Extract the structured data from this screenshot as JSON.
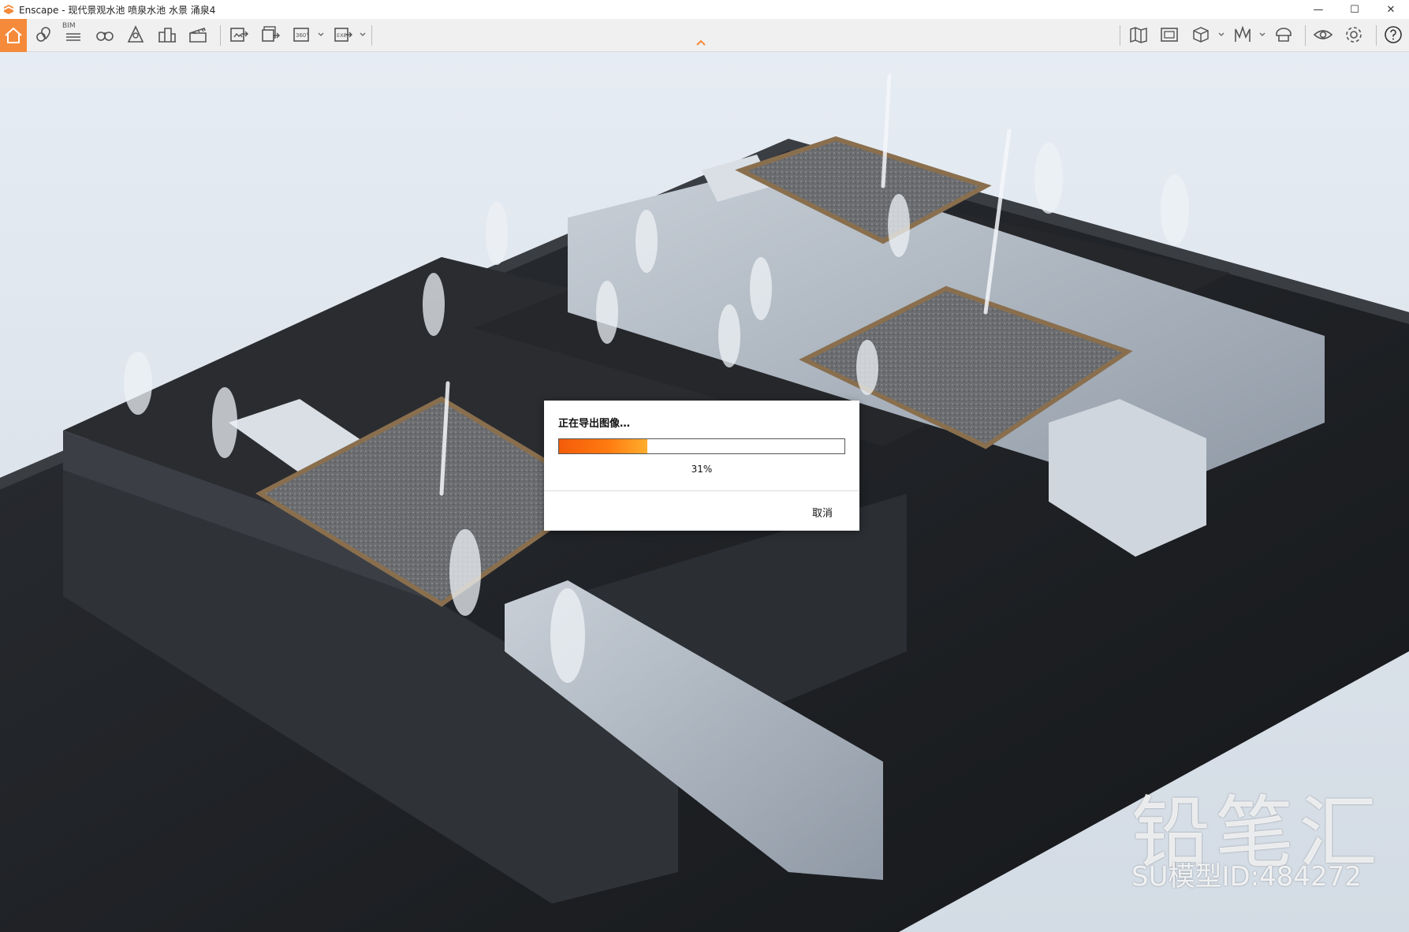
{
  "window": {
    "app_name": "Enscape",
    "title": "Enscape - 现代景观水池 喷泉水池 水景 涌泉4",
    "controls": [
      "—",
      "☐",
      "✕"
    ]
  },
  "toolbar": {
    "bim_label": "BIM",
    "icons": [
      "home-icon",
      "location-pin-icon",
      "bim-list-icon",
      "binoculars-icon",
      "walk-mode-icon",
      "buildings-icon",
      "clapperboard-icon",
      "screenshot-export-icon",
      "batch-export-icon",
      "panorama-360-icon",
      "exe-export-icon",
      "map-icon",
      "image-frame-icon",
      "cube-icon",
      "asset-library-icon",
      "helmet-icon",
      "eye-icon",
      "settings-icon",
      "help-icon"
    ]
  },
  "dialog": {
    "title": "正在导出图像…",
    "progress": 31,
    "progress_text": "31%",
    "cancel_label": "取消"
  },
  "watermark": {
    "brand": "铅笔汇",
    "model_id": "SU模型ID:484272"
  }
}
